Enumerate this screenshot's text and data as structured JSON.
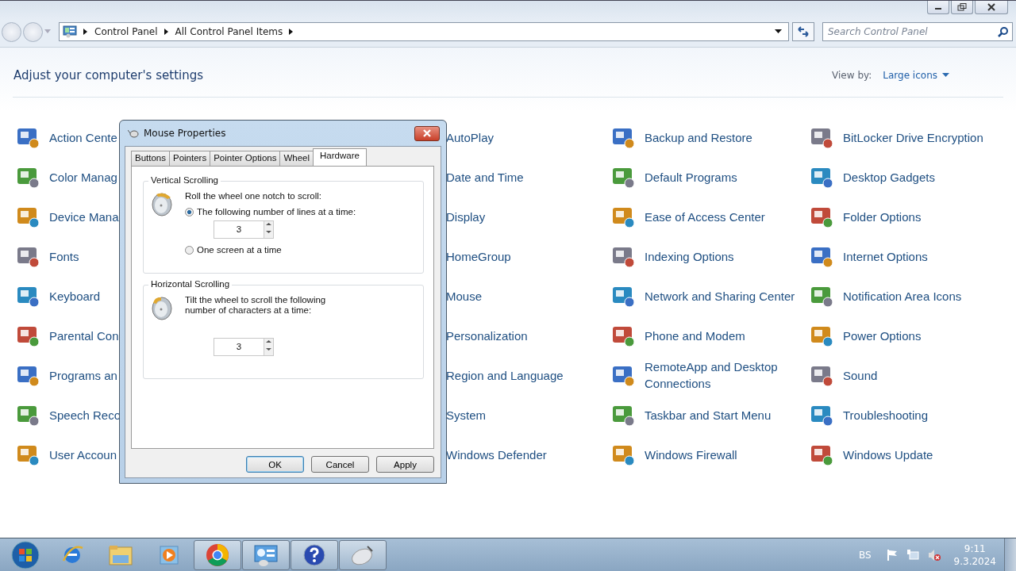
{
  "address_bar": {
    "breadcrumbs": [
      "Control Panel",
      "All Control Panel Items"
    ]
  },
  "search": {
    "placeholder": "Search Control Panel"
  },
  "heading": "Adjust your computer's settings",
  "view_by": {
    "label": "View by:",
    "value": "Large icons"
  },
  "columns": [
    {
      "kind": "icons",
      "items": [
        "Action Cente",
        "Color Manag",
        "Device Mana",
        "Fonts",
        "Keyboard",
        "Parental Con",
        "Programs an",
        "Speech Reco",
        "User Accoun"
      ]
    },
    {
      "kind": "labels",
      "items": [
        "AutoPlay",
        "Date and Time",
        "Display",
        "HomeGroup",
        "Mouse",
        "Personalization",
        "Region and Language",
        "System",
        "Windows Defender"
      ]
    },
    {
      "kind": "icons",
      "items": [
        "Backup and Restore",
        "Default Programs",
        "Ease of Access Center",
        "Indexing Options",
        "Network and Sharing Center",
        "Phone and Modem",
        "RemoteApp and Desktop Connections",
        "Taskbar and Start Menu",
        "Windows Firewall"
      ]
    },
    {
      "kind": "icons",
      "items": [
        "BitLocker Drive Encryption",
        "Desktop Gadgets",
        "Folder Options",
        "Internet Options",
        "Notification Area Icons",
        "Power Options",
        "Sound",
        "Troubleshooting",
        "Windows Update"
      ]
    }
  ],
  "dialog": {
    "title": "Mouse Properties",
    "tabs": [
      {
        "label": "Buttons",
        "selected": false
      },
      {
        "label": "Pointers",
        "selected": false
      },
      {
        "label": "Pointer Options",
        "selected": false
      },
      {
        "label": "Wheel",
        "selected": false
      },
      {
        "label": "Hardware",
        "selected": true
      }
    ],
    "vertical_scrolling": {
      "title": "Vertical Scrolling",
      "prompt": "Roll the wheel one notch to scroll:",
      "options": [
        {
          "label": "The following number of lines at a time:",
          "selected": true,
          "value": "3"
        },
        {
          "label": "One screen at a time",
          "selected": false
        }
      ]
    },
    "horizontal_scrolling": {
      "title": "Horizontal Scrolling",
      "prompt": "Tilt the wheel to scroll the following number of characters at a time:",
      "value": "3"
    },
    "buttons": [
      {
        "label": "OK",
        "default": true
      },
      {
        "label": "Cancel",
        "default": false
      },
      {
        "label": "Apply",
        "default": false
      }
    ]
  },
  "taskbar": {
    "apps": [
      {
        "kind": "start",
        "running": false
      },
      {
        "kind": "browser",
        "running": false
      },
      {
        "kind": "folder",
        "running": false
      },
      {
        "kind": "media",
        "running": false
      },
      {
        "kind": "chrome",
        "running": true
      },
      {
        "kind": "panel",
        "running": true
      },
      {
        "kind": "help",
        "running": true
      },
      {
        "kind": "mouse",
        "running": true
      }
    ],
    "language": "BS",
    "time": "9:11",
    "date": "9.3.2024"
  }
}
